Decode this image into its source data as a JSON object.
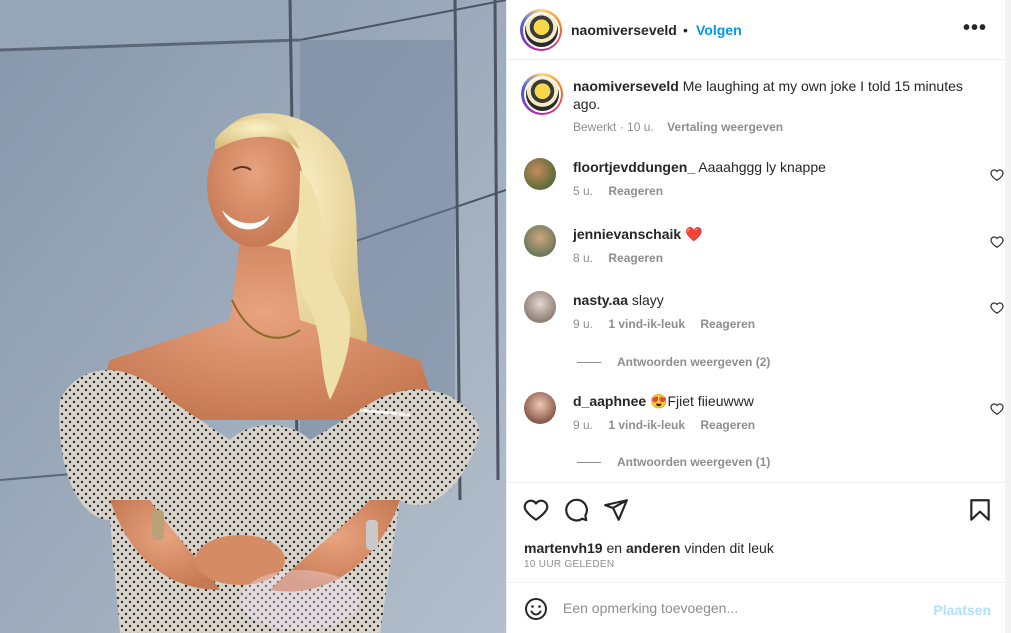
{
  "header": {
    "username": "naomiverseveld",
    "separator": "•",
    "follow_label": "Volgen",
    "more_icon": "more-horizontal-icon",
    "more_label": "•••"
  },
  "caption": {
    "username": "naomiverseveld",
    "text": "Me laughing at my own joke I told 15 minutes ago.",
    "edited": "Bewerkt",
    "time": "10 u.",
    "translate": "Vertaling weergeven"
  },
  "comments": [
    {
      "username": "floortjevddungen_",
      "text": "Aaaahggg ly knappe",
      "time": "5 u.",
      "likes": "",
      "reply": "Reageren"
    },
    {
      "username": "jennievanschaik",
      "text": "❤️",
      "time": "8 u.",
      "likes": "",
      "reply": "Reageren"
    },
    {
      "username": "nasty.aa",
      "text": "slayy",
      "time": "9 u.",
      "likes": "1 vind-ik-leuk",
      "reply": "Reageren",
      "view_replies": "Antwoorden weergeven (2)"
    },
    {
      "username": "d_aaphnee",
      "text": "😍Fjiet fiieuwww",
      "time": "9 u.",
      "likes": "1 vind-ik-leuk",
      "reply": "Reageren",
      "view_replies": "Antwoorden weergeven (1)"
    }
  ],
  "actions": {
    "like_icon": "heart-icon",
    "comment_icon": "comment-icon",
    "share_icon": "send-icon",
    "save_icon": "bookmark-icon"
  },
  "likes": {
    "user": "martenvh19",
    "middle": "en",
    "others": "anderen",
    "suffix": "vinden dit leuk"
  },
  "timestamp": "10 UUR GELEDEN",
  "add_comment": {
    "emoji_icon": "smiley-icon",
    "placeholder": "Een opmerking toevoegen...",
    "post_label": "Plaatsen"
  },
  "colors": {
    "link_blue": "#0095f6",
    "post_disabled": "#b2dffc",
    "secondary_text": "#8e8e8e",
    "like_red": "#ed4956"
  }
}
